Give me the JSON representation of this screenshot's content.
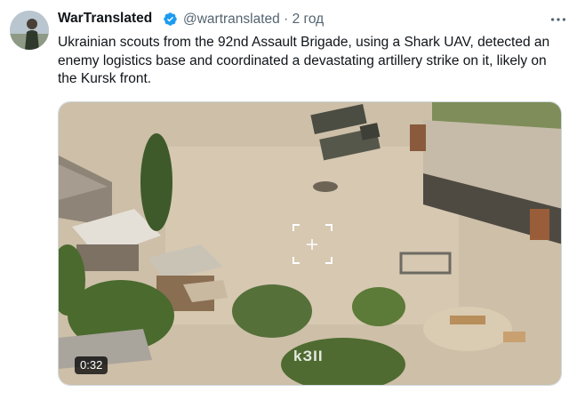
{
  "tweet": {
    "author_name": "WarTranslated",
    "handle": "@wartranslated",
    "separator": "·",
    "time": "2 год",
    "text": "Ukrainian scouts from the 92nd Assault Brigade, using a Shark UAV, detected an enemy logistics base and coordinated a devastating artillery strike on it, likely on the Kursk front.",
    "verified": true
  },
  "media": {
    "duration": "0:32",
    "watermark": "kЗII"
  },
  "icons": {
    "verified": "verified-badge-icon",
    "more": "more-options-icon",
    "target": "targeting-reticle-icon"
  },
  "colors": {
    "verified_blue": "#1d9bf0",
    "muted_text": "#536471"
  }
}
